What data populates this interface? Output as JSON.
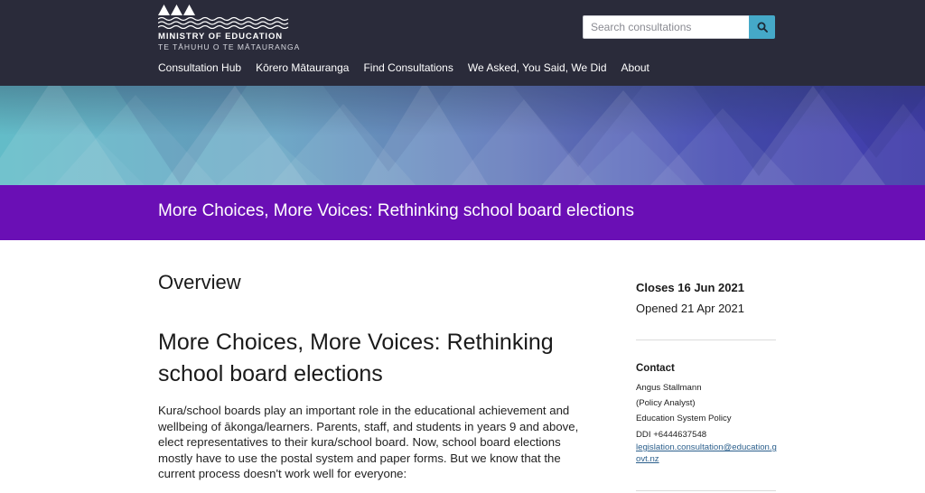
{
  "header": {
    "logo_title": "MINISTRY OF EDUCATION",
    "logo_subtitle": "TE TĀHUHU O TE MĀTAURANGA",
    "search": {
      "placeholder": "Search consultations",
      "icon": "search-icon"
    },
    "nav": [
      {
        "label": "Consultation Hub"
      },
      {
        "label": "Kōrero Mātauranga"
      },
      {
        "label": "Find Consultations"
      },
      {
        "label": "We Asked, You Said, We Did"
      },
      {
        "label": "About"
      }
    ]
  },
  "title_band": {
    "title": "More Choices, More Voices: Rethinking school board elections"
  },
  "main": {
    "section_heading": "Overview",
    "consultation_title": "More Choices, More Voices: Rethinking school board elections",
    "body": "Kura/school boards play an important role in the educational achievement and wellbeing of ākonga/learners. Parents, staff, and students in years 9 and above, elect representatives to their kura/school board. Now, school board elections mostly have to use the postal system and paper forms. But we know that the current process doesn't work well for everyone:"
  },
  "sidebar": {
    "closes": "Closes 16 Jun 2021",
    "opened": "Opened 21 Apr 2021",
    "contact": {
      "heading": "Contact",
      "name": "Angus Stallmann",
      "role": "(Policy Analyst)",
      "team": "Education System Policy",
      "phone": "DDI +6444637548",
      "email": "legislation.consultation@education.govt.nz"
    }
  },
  "colors": {
    "header_bg": "#2a2b3a",
    "accent_purple": "#6a0fb5",
    "search_button": "#45a9c8",
    "link": "#2b5f8c"
  }
}
